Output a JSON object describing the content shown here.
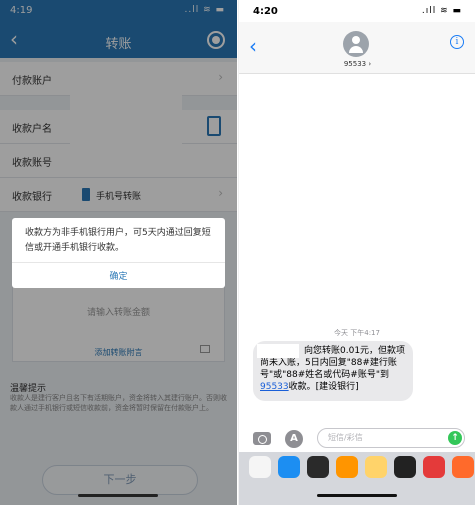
{
  "left": {
    "status": {
      "time": "4:19",
      "signal": "..ll ≋ ▬"
    },
    "nav": {
      "title": "转账",
      "back": "‹"
    },
    "rows": {
      "account": "付款账户",
      "payee_name": "收款户名",
      "payee_number": "收款账号",
      "bank": "收款银行",
      "bank_value": "手机号转账",
      "chevron": "›"
    },
    "amount_placeholder": "请输入转账金额",
    "memo_link": "添加转账附言",
    "tips_title": "温馨提示",
    "tips_body": "收款人是建行客户且名下有活期账户，资金将转入其建行账户。否则收款人通过手机银行或短信收款前，资金将暂时保留在付款账户上。",
    "next_button": "下一步",
    "dialog": {
      "message": "收款方为非手机银行用户，可5天内通过回复短信或开通手机银行收款。",
      "confirm": "确定"
    }
  },
  "right": {
    "status": {
      "time": "4:20",
      "signal": ".ıll ≋ ▬"
    },
    "contact": {
      "number": "95533",
      "name_suffix": " ›"
    },
    "info_label": "i",
    "timestamp": "今天 下午4:17",
    "message": {
      "part1": "向您转账0.01元，但款项尚未入账，5日内回复\"88#建行账号\"或\"88#姓名或代码#账号\"到",
      "number": "95533",
      "part2": "收款。[建设银行]"
    },
    "input_placeholder": "短信/彩信",
    "send_icon": "↑",
    "appstore_icon": "A",
    "app_icon_colors": [
      "#f5f5f5",
      "#1c8ef2",
      "#2a2a2a",
      "#ff9500",
      "#ffd36a",
      "#222222",
      "#e43a3a",
      "#ff6a2b"
    ]
  }
}
